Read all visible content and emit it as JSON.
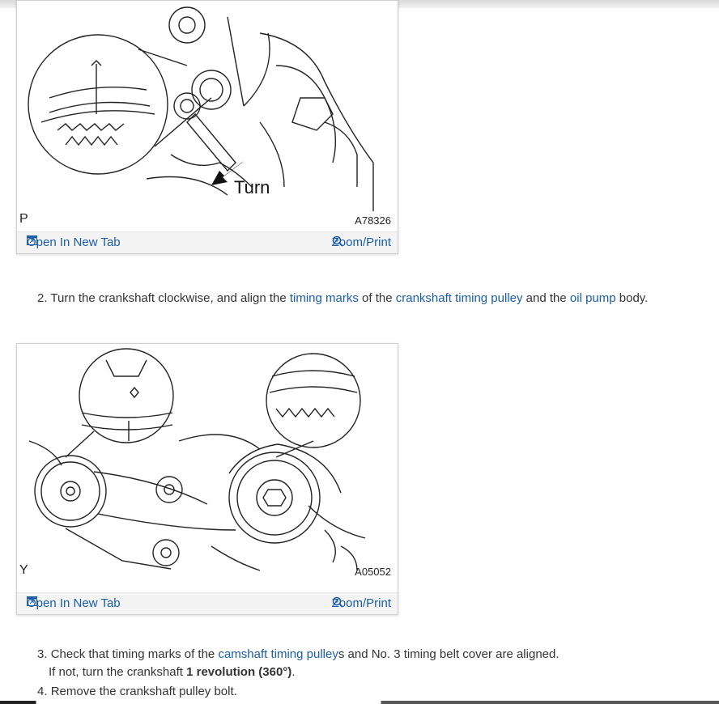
{
  "figure1": {
    "letter": "P",
    "code": "A78326",
    "turn_label": "Turn",
    "open_label": "Open In New Tab",
    "zoom_label": "Zoom/Print"
  },
  "step2": {
    "num": "2.",
    "t1": "Turn the crankshaft clockwise, and align the",
    "link1": "timing marks",
    "t2": "of the",
    "link2": "crankshaft timing pulley",
    "t3": "and the",
    "link3": "oil pump",
    "t4": "body."
  },
  "figure2": {
    "letter": "Y",
    "code": "A05052",
    "open_label": "Open In New Tab",
    "zoom_label": "Zoom/Print"
  },
  "step3": {
    "num": "3.",
    "t1": "Check that timing marks of the",
    "link1": "camshaft timing pulley",
    "t2": "s and No. 3 timing belt cover are aligned.",
    "sub_pre": "If not, turn the crankshaft",
    "sub_bold": "1 revolution (360°)",
    "sub_post": "."
  },
  "step4": {
    "num": "4.",
    "text": "Remove the crankshaft pulley bolt."
  },
  "colors": {
    "link": "#1a5da8",
    "text": "#333333",
    "panel": "#f4f4f4"
  },
  "icons": [
    "open-in-new-tab-icon",
    "zoom-magnifier-icon"
  ]
}
